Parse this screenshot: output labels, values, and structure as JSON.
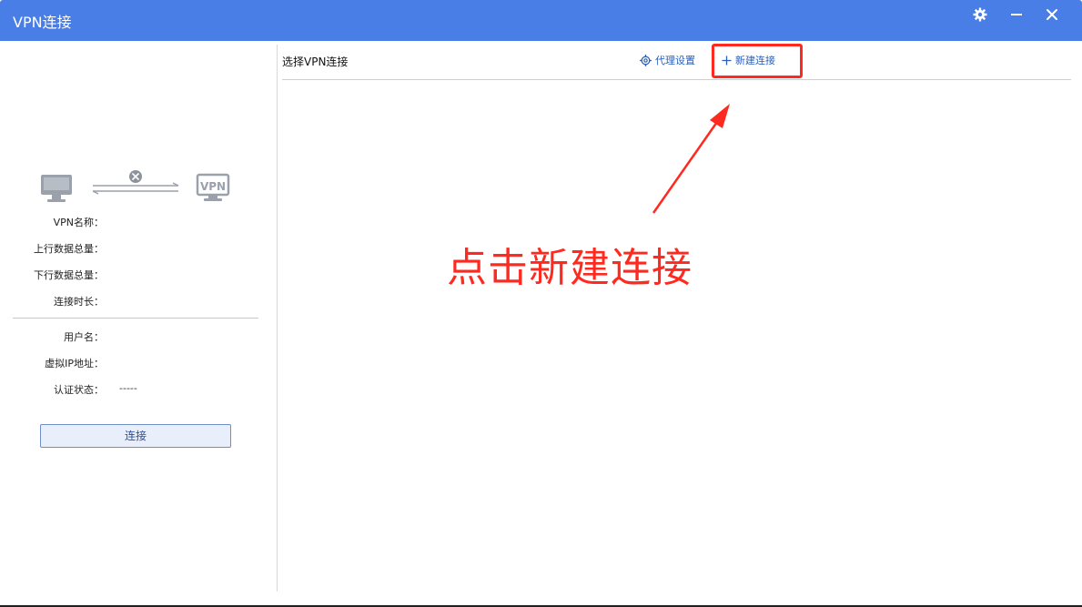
{
  "window": {
    "title": "VPN连接"
  },
  "titlebar": {
    "icons": [
      "gear-icon",
      "minimize-icon",
      "close-icon"
    ]
  },
  "left": {
    "info_rows": [
      {
        "label": "VPN名称：",
        "value": ""
      },
      {
        "label": "上行数据总量：",
        "value": ""
      },
      {
        "label": "下行数据总量：",
        "value": ""
      },
      {
        "label": "连接时长：",
        "value": ""
      }
    ],
    "account_rows": [
      {
        "label": "用户名：",
        "value": ""
      },
      {
        "label": "虚拟IP地址：",
        "value": ""
      },
      {
        "label": "认证状态：",
        "value": "-----"
      }
    ],
    "connect_label": "连接",
    "status_icons": [
      "computer-icon",
      "disconnected-icon",
      "vpn-icon"
    ],
    "vpn_text": "VPN"
  },
  "right": {
    "header": "选择VPN连接",
    "proxy_label": "代理设置",
    "new_label": "新建连接"
  },
  "annotation": {
    "text": "点击新建连接",
    "color": "#ff2a1f"
  },
  "colors": {
    "titlebar": "#4a7ee7",
    "link": "#2a5fb8",
    "annotation": "#ff2a1f"
  }
}
